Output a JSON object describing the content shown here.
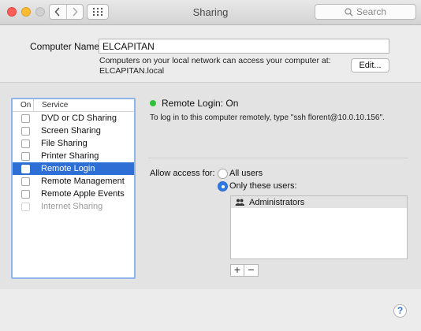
{
  "window": {
    "title": "Sharing"
  },
  "toolbar": {
    "search_placeholder": "Search"
  },
  "computer_name": {
    "label": "Computer Name:",
    "value": "ELCAPITAN",
    "description_line1": "Computers on your local network can access your computer at:",
    "description_line2": "ELCAPITAN.local",
    "edit_label": "Edit..."
  },
  "services": {
    "header_on": "On",
    "header_service": "Service",
    "items": [
      {
        "label": "DVD or CD Sharing",
        "checked": false
      },
      {
        "label": "Screen Sharing",
        "checked": false
      },
      {
        "label": "File Sharing",
        "checked": false
      },
      {
        "label": "Printer Sharing",
        "checked": false
      },
      {
        "label": "Remote Login",
        "checked": true,
        "selected": true
      },
      {
        "label": "Remote Management",
        "checked": false
      },
      {
        "label": "Remote Apple Events",
        "checked": false
      },
      {
        "label": "Internet Sharing",
        "checked": false,
        "disabled": true
      }
    ]
  },
  "detail": {
    "status": "Remote Login: On",
    "status_color": "#30c13b",
    "instructions": "To log in to this computer remotely, type \"ssh florent@10.0.10.156\".",
    "allow_label": "Allow access for:",
    "option_all": "All users",
    "option_only": "Only these users:",
    "users": [
      "Administrators"
    ],
    "add_label": "+",
    "remove_label": "−"
  },
  "help_label": "?",
  "colors": {
    "selection": "#2e6fd6",
    "accent": "#2f7ae2"
  }
}
